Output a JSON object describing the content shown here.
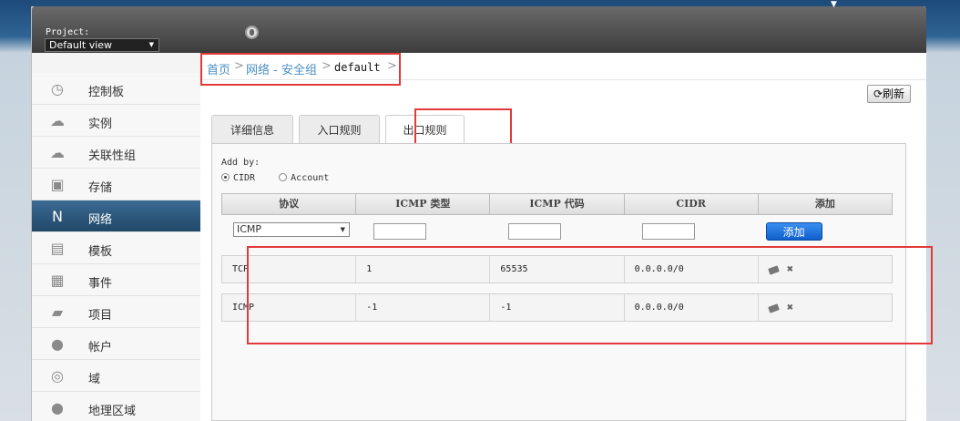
{
  "topbar": {
    "project_label": "Project:",
    "project_value": "Default view",
    "caret": "▼",
    "top_caret": "▼"
  },
  "sidebar": {
    "items": [
      {
        "label": "控制板",
        "icon": "dashboard-icon",
        "glyph": "◷"
      },
      {
        "label": "实例",
        "icon": "cloud-icon",
        "glyph": "☁"
      },
      {
        "label": "关联性组",
        "icon": "affinity-icon",
        "glyph": "☁"
      },
      {
        "label": "存储",
        "icon": "storage-icon",
        "glyph": "▣"
      },
      {
        "label": "网络",
        "icon": "network-icon",
        "glyph": "N"
      },
      {
        "label": "模板",
        "icon": "template-icon",
        "glyph": "▤"
      },
      {
        "label": "事件",
        "icon": "calendar-icon",
        "glyph": "▦"
      },
      {
        "label": "项目",
        "icon": "folder-icon",
        "glyph": "▰"
      },
      {
        "label": "帐户",
        "icon": "user-icon",
        "glyph": "●"
      },
      {
        "label": "域",
        "icon": "domain-icon",
        "glyph": "◎"
      },
      {
        "label": "地理区域",
        "icon": "globe-icon",
        "glyph": "●"
      }
    ]
  },
  "breadcrumb": {
    "home": "首页",
    "network": "网络 - 安全组",
    "current": "default",
    "sep": ">"
  },
  "toolbar": {
    "refresh_label": "刷新",
    "refresh_glyph": "⟳"
  },
  "tabs": [
    "详细信息",
    "入口规则",
    "出口规则"
  ],
  "form": {
    "add_by": "Add by:",
    "cidr": "CIDR",
    "account": "Account",
    "headers": [
      "协议",
      "ICMP 类型",
      "ICMP 代码",
      "CIDR",
      "添加"
    ],
    "protocol_selected": "ICMP",
    "add_button": "添加"
  },
  "rules": [
    {
      "protocol": "TCP",
      "type": "1",
      "code": "65535",
      "cidr": "0.0.0.0/0"
    },
    {
      "protocol": "ICMP",
      "type": "-1",
      "code": "-1",
      "cidr": "0.0.0.0/0"
    }
  ],
  "colors": {
    "highlight": "#e23a3a",
    "accent": "#0f5fcc",
    "active_nav": "#214868"
  }
}
